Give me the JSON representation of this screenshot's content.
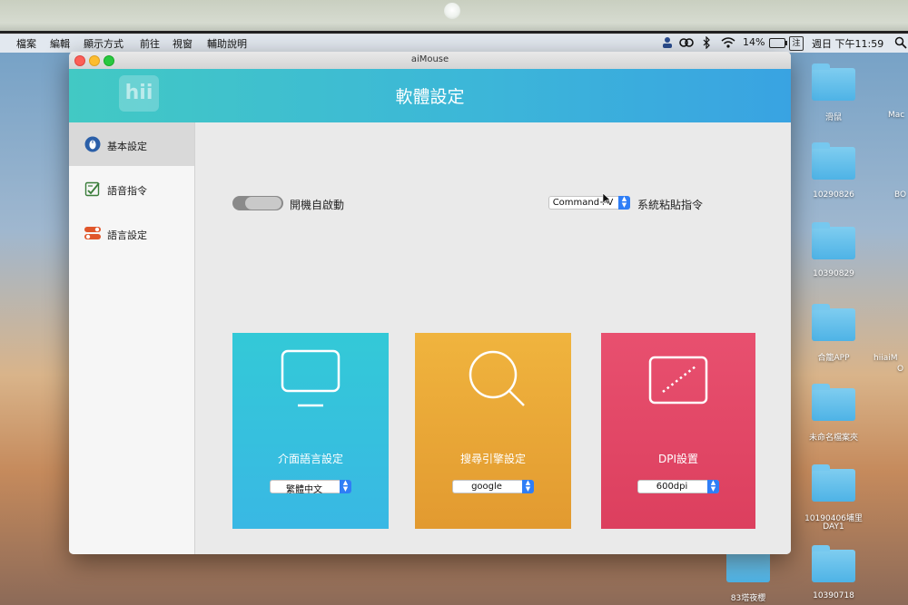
{
  "menubar": {
    "apple": "",
    "items": [
      "檔案",
      "編輯",
      "顯示方式",
      "前往",
      "視窗",
      "輔助說明"
    ],
    "battery_percent": "14%",
    "input_source": "注",
    "clock": "週日 下午11:59"
  },
  "desktop": {
    "labels": [
      "滑鼠",
      "10290826",
      "10390829",
      "合籠APP",
      "未命名檔案夾",
      "10190406埔里",
      "DAY1",
      "10390718",
      "83塔夜櫻",
      "Mac",
      "BO",
      "hiiaiM",
      "O"
    ]
  },
  "window": {
    "title": "aiMouse",
    "logo_text": "hii",
    "header_title": "軟體設定"
  },
  "sidebar": {
    "items": [
      {
        "label": "基本設定",
        "icon": "mouse-icon"
      },
      {
        "label": "語音指令",
        "icon": "voice-command-icon"
      },
      {
        "label": "語言設定",
        "icon": "language-toggle-icon"
      }
    ]
  },
  "settings": {
    "auto_start_label": "開機自啟動",
    "auto_start_on": false,
    "paste_shortcut_value": "Command+V",
    "paste_shortcut_label": "系統粘貼指令"
  },
  "cards": [
    {
      "title": "介面語言設定",
      "select_value": "繁體中文",
      "icon": "monitor-icon",
      "color": "#37c6d8"
    },
    {
      "title": "搜尋引擎設定",
      "select_value": "google",
      "icon": "search-icon",
      "color": "#e8a836"
    },
    {
      "title": "DPI設置",
      "select_value": "600dpi",
      "icon": "dpi-icon",
      "color": "#e0496a"
    }
  ],
  "colors": {
    "header_start": "#42c9c4",
    "header_end": "#39a3e2",
    "select_arrow": "#2f7ef6"
  }
}
